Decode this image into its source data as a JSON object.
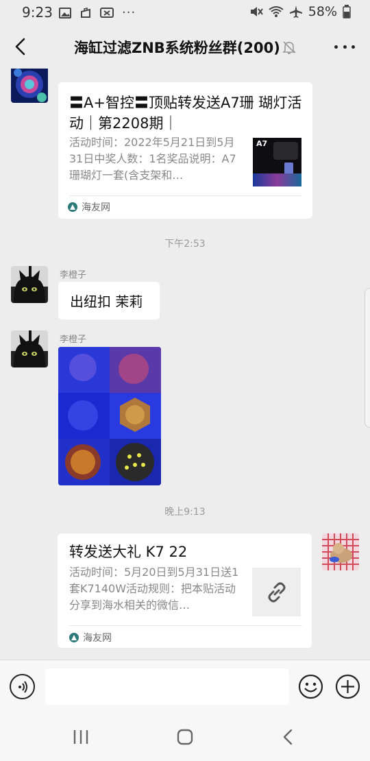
{
  "status": {
    "time": "9:23",
    "battery": "58%"
  },
  "nav": {
    "title": "海缸过滤ZNB系统粉丝群(200)"
  },
  "messages": {
    "card1": {
      "title": "〓A+智控〓顶贴转发送A7珊 瑚灯活动｜第2208期｜",
      "desc": "活动时间：2022年5月21日到5月31日中奖人数：1名奖品说明：A7珊瑚灯一套(含支架和…",
      "source": "海友网",
      "thumb_label": "A7"
    },
    "ts1": "下午2:53",
    "msg2": {
      "sender": "李橙子",
      "text": "出纽扣 茉莉"
    },
    "msg3": {
      "sender": "李橙子"
    },
    "ts2": "晚上9:13",
    "card2": {
      "title": "转发送大礼 K7 22",
      "desc": "活动时间：5月20日到5月31日送1套K7140W活动规则：把本贴活动分享到海水相关的微信…",
      "source": "海友网"
    }
  },
  "colors": {
    "background": "#ededed",
    "bubble": "#ffffff",
    "meta_text": "#888888"
  }
}
